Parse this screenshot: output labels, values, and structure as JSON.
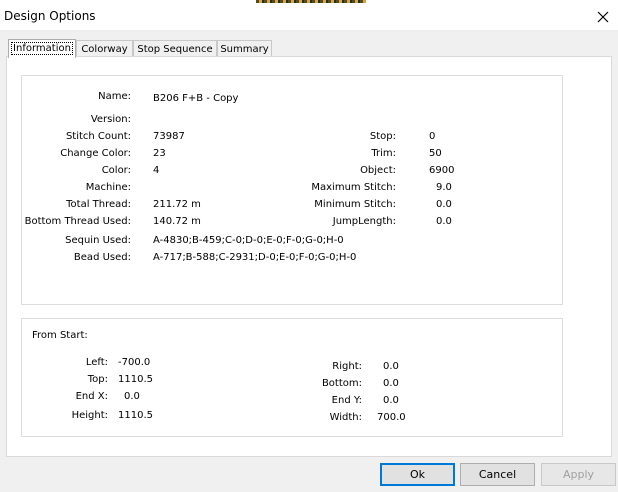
{
  "window": {
    "title": "Design Options"
  },
  "tabs": [
    "Information",
    "Colorway",
    "Stop Sequence",
    "Summary"
  ],
  "info": {
    "name": {
      "label": "Name:",
      "value": "B206 F+B - Copy"
    },
    "left": [
      {
        "label": "Version:",
        "value": ""
      },
      {
        "label": "Stitch Count:",
        "value": "73987"
      },
      {
        "label": "Change Color:",
        "value": "23"
      },
      {
        "label": "Color:",
        "value": "4"
      },
      {
        "label": "Machine:",
        "value": ""
      },
      {
        "label": "Total Thread:",
        "value": "211.72 m"
      },
      {
        "label": "Bottom Thread Used:",
        "value": "140.72 m"
      },
      {
        "label": "Sequin Used:",
        "value": "A-4830;B-459;C-0;D-0;E-0;F-0;G-0;H-0"
      },
      {
        "label": "Bead Used:",
        "value": "A-717;B-588;C-2931;D-0;E-0;F-0;G-0;H-0"
      }
    ],
    "right": [
      {
        "label": "Stop:",
        "value": "0"
      },
      {
        "label": "Trim:",
        "value": "50"
      },
      {
        "label": "Object:",
        "value": "6900"
      },
      {
        "label": "Maximum Stitch:",
        "value": "9.0"
      },
      {
        "label": "Minimum Stitch:",
        "value": "0.0"
      },
      {
        "label": "JumpLength:",
        "value": "0.0"
      }
    ]
  },
  "from_start": {
    "heading": "From Start:",
    "left": [
      {
        "label": "Left:",
        "value": "-700.0"
      },
      {
        "label": "Top:",
        "value": "1110.5"
      },
      {
        "label": "End X:",
        "value": "0.0"
      },
      {
        "label": "Height:",
        "value": "1110.5"
      }
    ],
    "right": [
      {
        "label": "Right:",
        "value": "0.0"
      },
      {
        "label": "Bottom:",
        "value": "0.0"
      },
      {
        "label": "End Y:",
        "value": "0.0"
      },
      {
        "label": "Width:",
        "value": "700.0"
      }
    ]
  },
  "buttons": {
    "ok": "Ok",
    "cancel": "Cancel",
    "apply": "Apply"
  }
}
